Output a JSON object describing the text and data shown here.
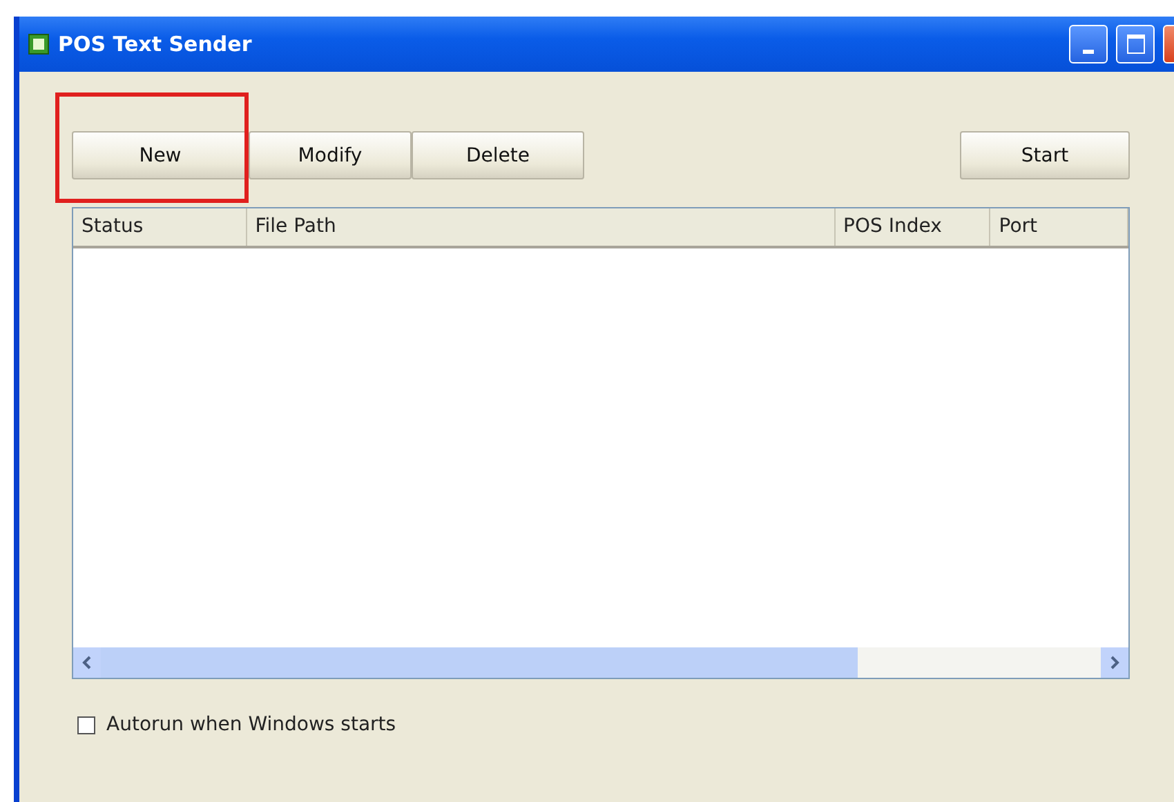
{
  "window": {
    "title": "POS Text Sender"
  },
  "buttons": [
    {
      "label": "New",
      "highlighted": true
    },
    {
      "label": "Modify",
      "highlighted": false
    },
    {
      "label": "Delete",
      "highlighted": false
    }
  ],
  "start_button": {
    "label": "Start"
  },
  "table": {
    "columns": [
      "Status",
      "File Path",
      "POS Index",
      "Port"
    ]
  },
  "autorun": {
    "label": "Autorun when Windows starts",
    "checked": false
  }
}
